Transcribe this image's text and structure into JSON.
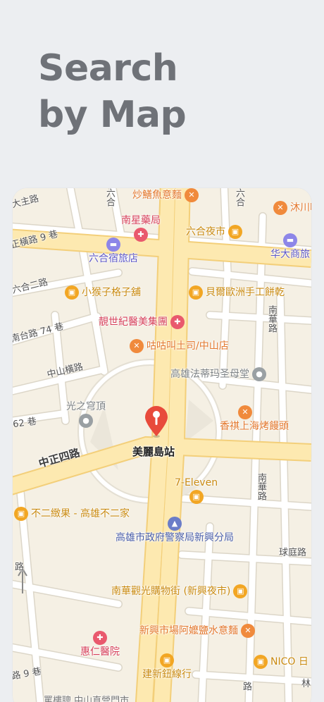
{
  "headline": {
    "line1": "Search",
    "line2": "by Map"
  },
  "map": {
    "station": "美麗島站",
    "streets": {
      "zhongzheng4": "中正四路",
      "zhongshanheng": "中山橫路",
      "nanhua1": "南華路",
      "nanhua2": "南華路",
      "liuhe_top": "六合",
      "liuhe_top2": "六合",
      "qiuting": "球庭路",
      "zhengjing9": "正橫路 9 巷",
      "liuhe2": "六合二路",
      "nantai74": "南台路 74 巷",
      "lane62": "62 巷",
      "lane9b": "路 9 巷",
      "dazhu": "大主路",
      "lin": "林",
      "bottom_road": "路",
      "bottom_cut": "四路",
      "bottom_partial": "罵樓聰 中山直營門市",
      "left_edge": "路"
    },
    "pois": {
      "chao_shan": "炒鱔魚意麵",
      "nanxing": "南星藥局",
      "liuhe_market": "六合夜市",
      "muchuan": "沐川咖",
      "liuhe_hostel": "六合宿旅店",
      "huada": "华大商旅",
      "monkey": "小猴子格子舖",
      "bellet": "貝爾歐洲手工餅乾",
      "jingshi": "靚世紀醫美集團",
      "gugu": "咕咕叫土司/中山店",
      "cathedral": "高雄法蒂玛圣母堂",
      "dome": "光之穹頂",
      "xiangqi": "香祺上海烤饅頭",
      "seven": "7-Eleven",
      "buer": "不二緻果 - 高雄不二家",
      "police": "高雄市政府警察局新興分局",
      "nanhua_mall": "南華觀光購物街 (新興夜市)",
      "ama": "新興市場阿嬤鹽水意麵",
      "huiren": "惠仁醫院",
      "nico": "NICO 日",
      "jianxin": "建新鈕線行"
    },
    "icons": {
      "food": "fork-knife-icon",
      "shop": "bag-icon",
      "health": "medical-icon",
      "hotel": "bed-icon",
      "civic": "building-icon"
    },
    "colors": {
      "land": "#f5f0e4",
      "road": "#ffffff",
      "major_road": "#fde9b0",
      "major_road_edge": "#f3cf7a",
      "pin": "#e84a3b"
    }
  }
}
